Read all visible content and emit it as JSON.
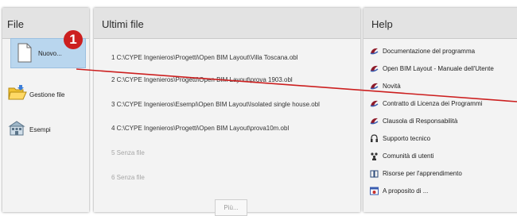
{
  "file_panel": {
    "title": "File",
    "items": [
      {
        "label": "Nuovo...",
        "icon": "new-document-icon"
      },
      {
        "label": "Gestione file",
        "icon": "folder-icon"
      },
      {
        "label": "Esempi",
        "icon": "examples-icon"
      }
    ]
  },
  "recent_panel": {
    "title": "Ultimi file",
    "items": [
      "1 C:\\CYPE Ingenieros\\Progetti\\Open BIM Layout\\Villa Toscana.obl",
      "2 C:\\CYPE Ingenieros\\Progetti\\Open BIM Layout\\prova 1903.obl",
      "3 C:\\CYPE Ingenieros\\Esempi\\Open BIM Layout\\Isolated single house.obl",
      "4 C:\\CYPE Ingenieros\\Progetti\\Open BIM Layout\\prova10m.obl",
      "5 Senza file",
      "6 Senza file"
    ],
    "more_label": "Più..."
  },
  "help_panel": {
    "title": "Help",
    "items": [
      {
        "label": "Documentazione del programma",
        "icon": "cype-logo-icon"
      },
      {
        "label": "Open BIM Layout - Manuale dell'Utente",
        "icon": "cype-logo-icon"
      },
      {
        "label": "Novità",
        "icon": "cype-logo-icon"
      },
      {
        "label": "Contratto di Licenza dei Programmi",
        "icon": "cype-logo-icon"
      },
      {
        "label": "Clausola di Responsabilità",
        "icon": "cype-logo-icon"
      },
      {
        "label": "Supporto tecnico",
        "icon": "headset-icon"
      },
      {
        "label": "Comunità di utenti",
        "icon": "community-icon"
      },
      {
        "label": "Risorse per l'apprendimento",
        "icon": "book-icon"
      },
      {
        "label": "A proposito di ...",
        "icon": "about-icon"
      }
    ]
  },
  "annotation": {
    "number": "1",
    "color": "#cc1f1f"
  }
}
